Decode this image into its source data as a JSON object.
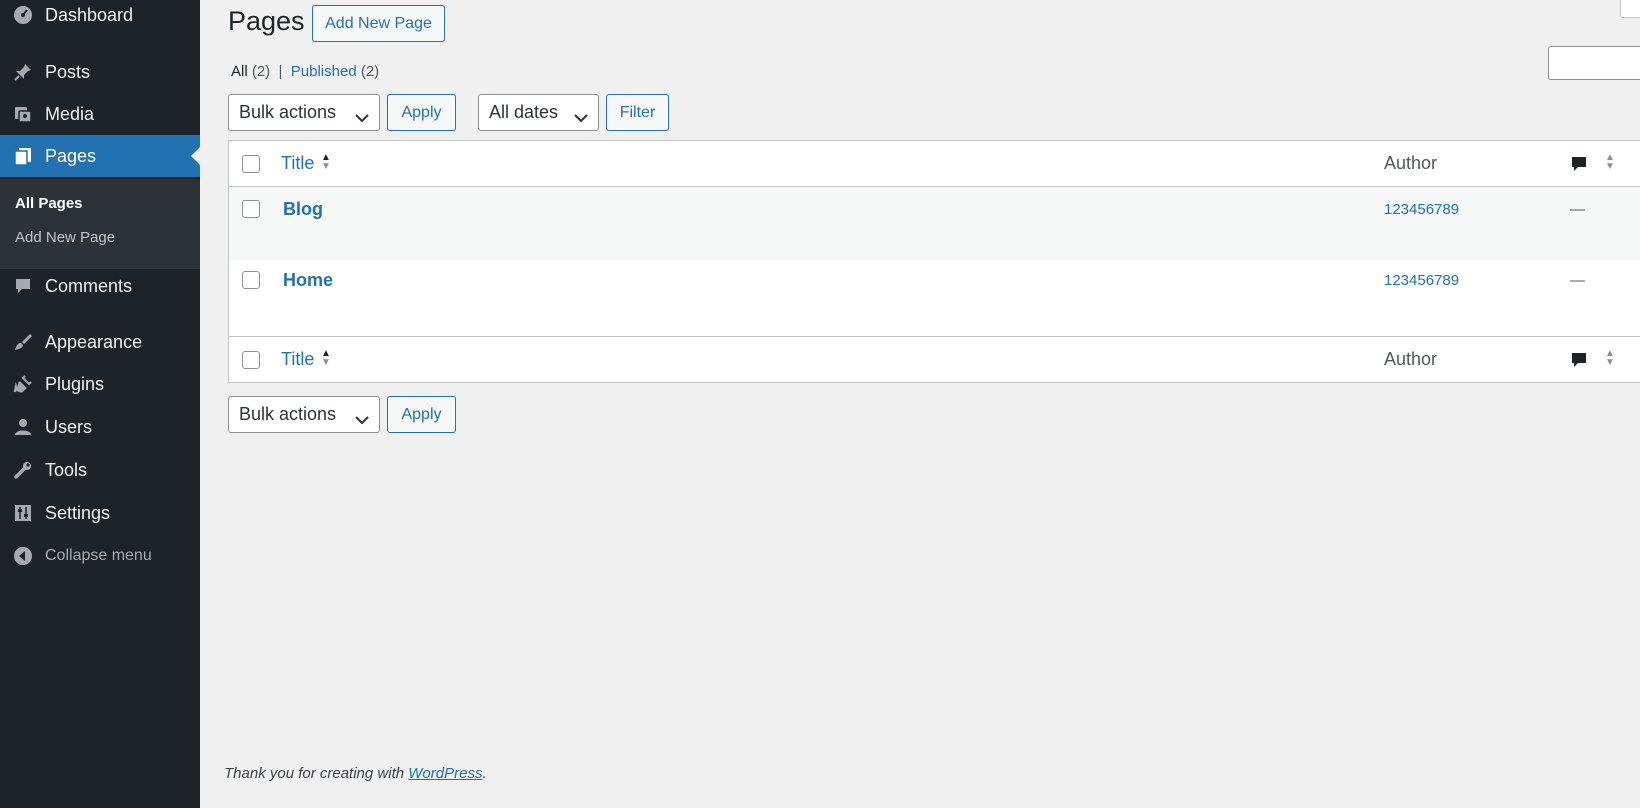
{
  "sidebar": {
    "items": [
      {
        "label": "Dashboard",
        "icon": "dashboard-icon"
      },
      {
        "label": "Posts",
        "icon": "pin-icon"
      },
      {
        "label": "Media",
        "icon": "media-icon"
      },
      {
        "label": "Pages",
        "icon": "pages-icon"
      },
      {
        "label": "Comments",
        "icon": "comment-icon"
      },
      {
        "label": "Appearance",
        "icon": "brush-icon"
      },
      {
        "label": "Plugins",
        "icon": "plug-icon"
      },
      {
        "label": "Users",
        "icon": "user-icon"
      },
      {
        "label": "Tools",
        "icon": "wrench-icon"
      },
      {
        "label": "Settings",
        "icon": "settings-icon"
      }
    ],
    "submenu": [
      "All Pages",
      "Add New Page"
    ],
    "collapse_label": "Collapse menu"
  },
  "header": {
    "title": "Pages",
    "add_new_label": "Add New Page"
  },
  "views": {
    "all_label": "All",
    "all_count": "(2)",
    "separator": "|",
    "published_label": "Published",
    "published_count": "(2)"
  },
  "tablenav": {
    "bulk_actions": "Bulk actions",
    "apply_label": "Apply",
    "dates_filter": "All dates",
    "filter_label": "Filter"
  },
  "table": {
    "columns": {
      "title": "Title",
      "author": "Author"
    },
    "rows": [
      {
        "title": "Blog",
        "author": "123456789",
        "comments": "—"
      },
      {
        "title": "Home",
        "author": "123456789",
        "comments": "—"
      }
    ]
  },
  "footer": {
    "text": "Thank you for creating with ",
    "link": "WordPress",
    "end": "."
  },
  "colors": {
    "sidebar_bg": "#1d2327",
    "accent": "#2271b1",
    "page_bg": "#f0f0f1"
  }
}
